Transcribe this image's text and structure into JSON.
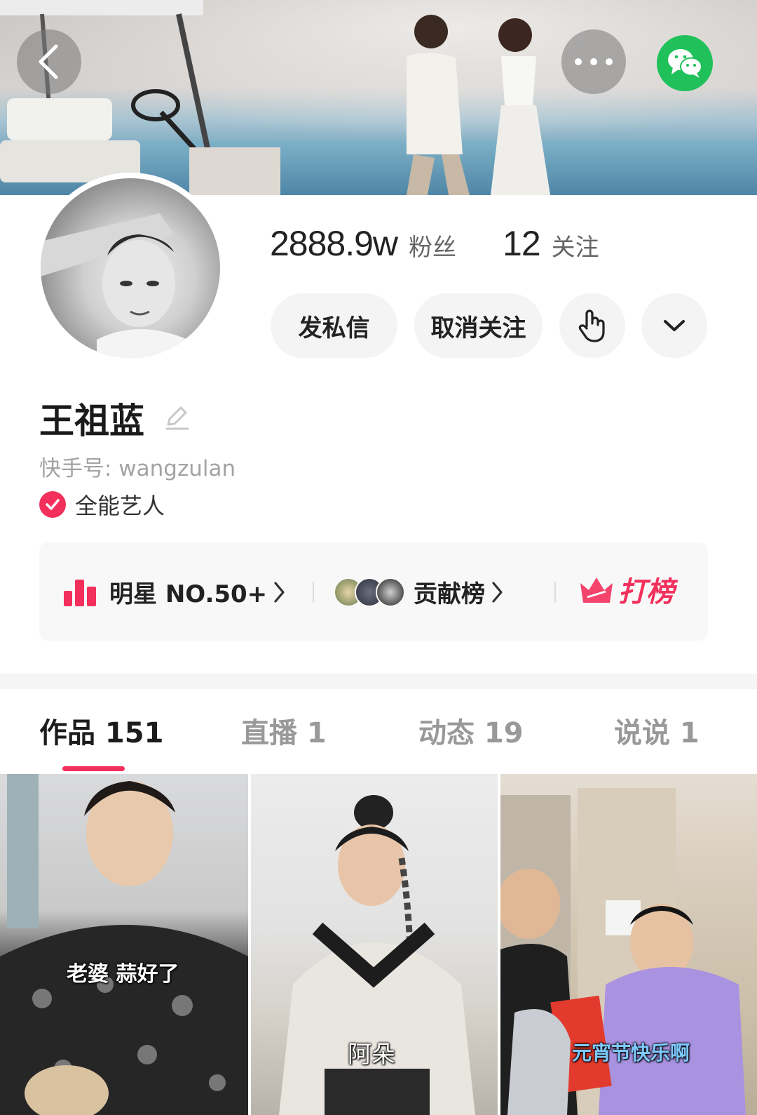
{
  "header": {
    "back_icon": "chevron-left-icon",
    "more_icon": "more-horizontal-icon",
    "share_icon": "wechat-icon",
    "wechat_color": "#20c15b"
  },
  "profile": {
    "followers_count": "2888.9w",
    "followers_label": "粉丝",
    "following_count": "12",
    "following_label": "关注",
    "name": "王祖蓝",
    "kwai_id": "快手号: wangzulan",
    "verification": "全能艺人"
  },
  "actions": {
    "message_label": "发私信",
    "unfollow_label": "取消关注",
    "gesture_icon": "tap-hand-icon",
    "expand_icon": "chevron-down-icon"
  },
  "ranking": {
    "star_label": "明星 NO.50+",
    "contribution_label": "贡献榜",
    "vote_label": "打榜",
    "accent_color": "#f3305c"
  },
  "tabs": [
    {
      "label": "作品 151",
      "active": true
    },
    {
      "label": "直播 1",
      "active": false
    },
    {
      "label": "动态 19",
      "active": false
    },
    {
      "label": "说说 1",
      "active": false
    }
  ],
  "works": [
    {
      "caption": "老婆 蒜好了"
    },
    {
      "caption": "阿朵"
    },
    {
      "caption": "元宵节快乐啊"
    }
  ]
}
